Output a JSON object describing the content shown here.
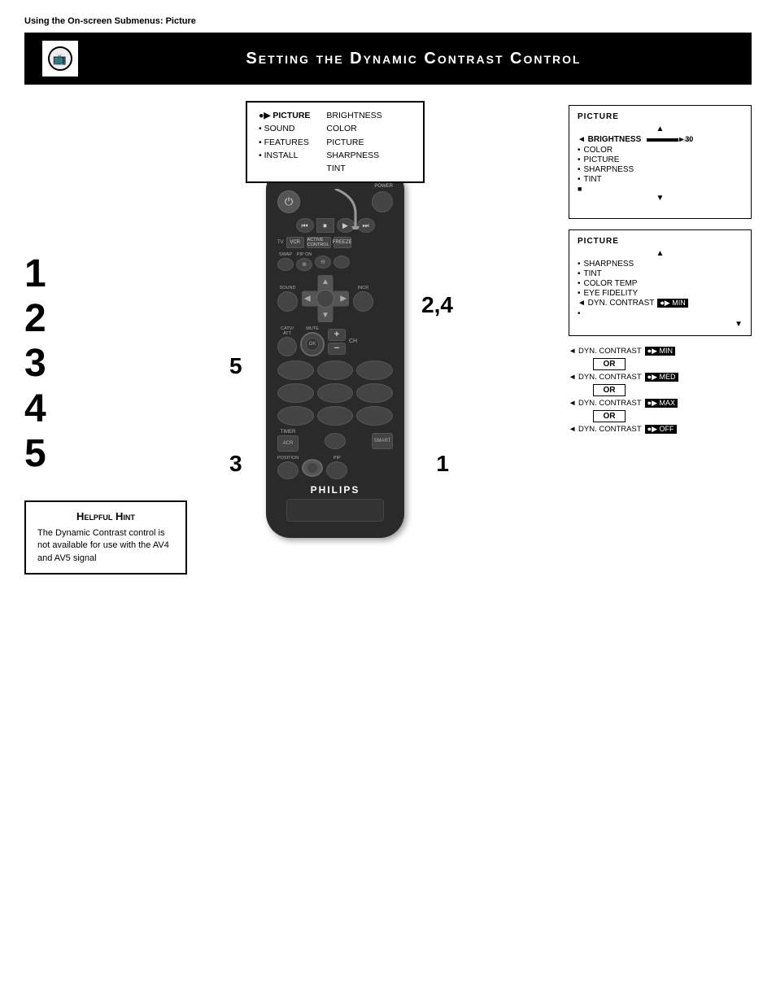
{
  "page": {
    "subtitle": "Using the On-screen Submenus: Picture",
    "title": "Setting the Dynamic Contrast Control"
  },
  "steps": [
    "1",
    "2",
    "3",
    "4",
    "5"
  ],
  "step_labels_on_remote": {
    "step1": "1",
    "step24": "2,4",
    "step3": "3",
    "step5": "5"
  },
  "onscreen_menu": {
    "left_items": [
      {
        "label": "●▶ PICTURE",
        "selected": true
      },
      {
        "label": "• SOUND",
        "selected": false
      },
      {
        "label": "• FEATURES",
        "selected": false
      },
      {
        "label": "• INSTALL",
        "selected": false
      }
    ],
    "right_items": [
      {
        "label": "BRIGHTNESS"
      },
      {
        "label": "COLOR"
      },
      {
        "label": "PICTURE"
      },
      {
        "label": "SHARPNESS"
      },
      {
        "label": "TINT"
      }
    ]
  },
  "picture_menu_1": {
    "title": "PICTURE",
    "items": [
      {
        "label": "◄ BRIGHTNESS",
        "selected": true,
        "has_bar": true,
        "bar_value": "►30"
      },
      {
        "label": "• COLOR",
        "selected": false
      },
      {
        "label": "• PICTURE",
        "selected": false
      },
      {
        "label": "• SHARPNESS",
        "selected": false
      },
      {
        "label": "• TINT",
        "selected": false
      },
      {
        "label": "■",
        "selected": false
      }
    ]
  },
  "picture_menu_2": {
    "title": "PICTURE",
    "items": [
      {
        "label": "• SHARPNESS"
      },
      {
        "label": "• TINT"
      },
      {
        "label": "• COLOR TEMP"
      },
      {
        "label": "• EYE FIDELITY"
      },
      {
        "label": "◄ DYN. CONTRAST",
        "value": "●▶ MIN",
        "inverted": true
      },
      {
        "label": "•"
      }
    ]
  },
  "dyn_contrast_options": [
    {
      "label": "◄ DYN. CONTRAST",
      "value": "●▶ MIN",
      "or": true
    },
    {
      "label": "◄ DYN. CONTRAST",
      "value": "●▶ MED",
      "or": true
    },
    {
      "label": "◄ DYN. CONTRAST",
      "value": "●▶ MAX",
      "or": true
    },
    {
      "label": "◄ DYN. CONTRAST",
      "value": "●▶ OFF",
      "or": false
    }
  ],
  "helpful_hint": {
    "title": "Helpful Hint",
    "text": "The Dynamic Contrast control is not available for use with the AV4 and AV5 signal"
  },
  "remote": {
    "brand": "PHILIPS",
    "buttons": {
      "power_label": "POWER",
      "ch_label": "CH",
      "plus": "+",
      "minus": "−"
    }
  }
}
